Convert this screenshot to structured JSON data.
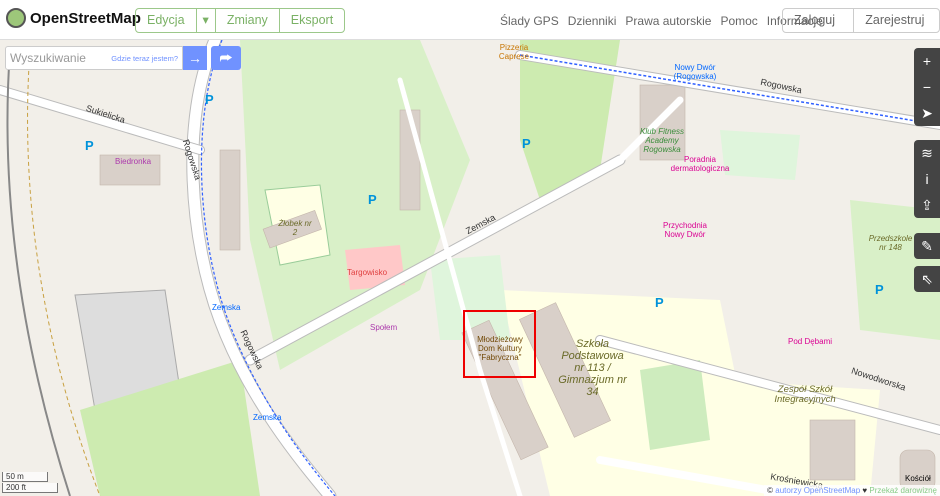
{
  "header": {
    "brand": "OpenStreetMap",
    "edit": "Edycja",
    "changes": "Zmiany",
    "export": "Eksport",
    "nav": [
      "Ślady GPS",
      "Dzienniki",
      "Prawa autorskie",
      "Pomoc",
      "Informacje"
    ],
    "login": "Zaloguj się",
    "signup": "Zarejestruj się"
  },
  "search": {
    "placeholder": "Wyszukiwanie",
    "where": "Gdzie teraz jestem?",
    "go": "→",
    "directions": "⮫"
  },
  "controls": {
    "zoom_in": "+",
    "zoom_out": "−",
    "locate": "➤",
    "layers": "≋",
    "info": "i",
    "share": "⇪",
    "note": "✎",
    "query": "⇖"
  },
  "scale": {
    "metric": "50 m",
    "imperial": "200 ft"
  },
  "attribution": {
    "copy": "©",
    "authors": "autorzy OpenStreetMap",
    "heart": "♥",
    "donate": "Przekaż darowiznę"
  },
  "map_labels": {
    "rogowska1": "Rogowska",
    "rogowska2": "Rogowska",
    "rogowska3": "Rogowska",
    "sukielicka": "Sukielicka",
    "zemska_road": "Zemska",
    "nowodworska": "Nowodworska",
    "krosniewicka": "Krośniewicka",
    "biedronka": "Biedronka",
    "spolem": "Społem",
    "targowisko": "Targowisko",
    "zlobek": "Żłobek nr 2",
    "mdk": "Młodzieżowy Dom Kultury \"Fabryczna\"",
    "school": "Szkoła Podstawowa nr 113 / Gimnazjum nr 34",
    "zespol": "Zespół Szkół Integracyjnych",
    "przedszkole": "Przedszkole nr 148",
    "pizzeria": "Pizzeria Caprese",
    "nowy_dwor_stop": "Nowy Dwór (Rogowska)",
    "zemska_stop1": "Zemska",
    "zemska_stop2": "Zemska",
    "fitness": "Klub Fitness Academy Rogowska",
    "poradnia": "Poradnia dermatologiczna",
    "przychodnia": "Przychodnia Nowy Dwór",
    "pod_debami": "Pod Dębami",
    "kosciol": "Kościół"
  },
  "colors": {
    "accent": "#7092ff",
    "brand_green": "#7ab165",
    "highlight": "#ee0000"
  }
}
